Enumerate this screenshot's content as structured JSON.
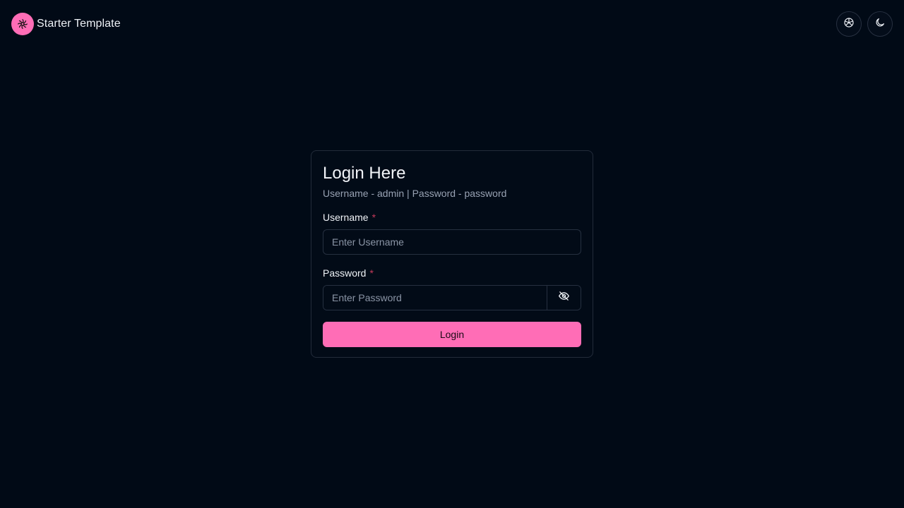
{
  "header": {
    "brand_name": "Starter Template",
    "logo_icon": "flower-icon",
    "actions": [
      {
        "icon": "theme-palette-icon"
      },
      {
        "icon": "moon-icon"
      }
    ]
  },
  "login": {
    "title": "Login Here",
    "subtitle": "Username - admin | Password - password",
    "username": {
      "label": "Username",
      "required_mark": "*",
      "placeholder": "Enter Username",
      "value": ""
    },
    "password": {
      "label": "Password",
      "required_mark": "*",
      "placeholder": "Enter Password",
      "value": "",
      "toggle_icon": "eye-off-icon"
    },
    "submit_label": "Login"
  },
  "colors": {
    "background": "#010a16",
    "accent": "#ff6db6",
    "border": "#263040",
    "required": "#c43a5a",
    "muted_text": "#98a2b3"
  }
}
